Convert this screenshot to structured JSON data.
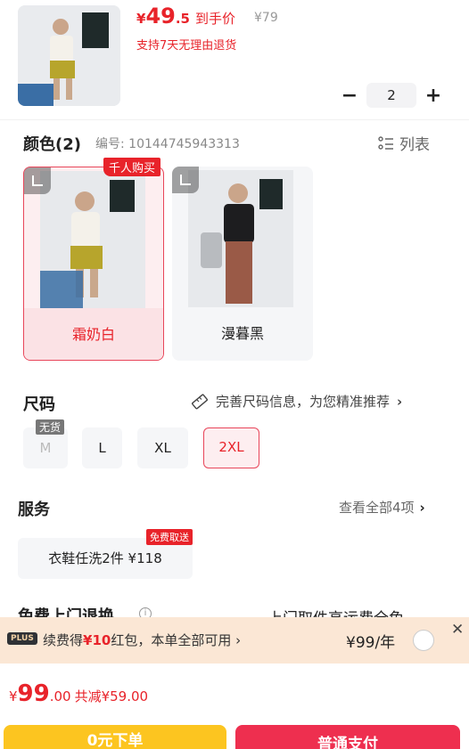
{
  "product": {
    "price_symbol": "¥",
    "price_int": "49",
    "price_dec": ".5",
    "price_label": "到手价",
    "original_price": "¥79",
    "return_policy": "支持7天无理由退货",
    "quantity": "2"
  },
  "color": {
    "title": "颜色(2)",
    "code": "编号: 10144745943313",
    "list_label": "列表",
    "hot_badge": "千人购买",
    "options": [
      {
        "name": "霜奶白",
        "selected": true
      },
      {
        "name": "漫暮黑",
        "selected": false
      }
    ]
  },
  "size": {
    "title": "尺码",
    "hint": "完善尺码信息，为您精准推荐",
    "no_stock": "无货",
    "options": [
      {
        "label": "M",
        "state": "disabled"
      },
      {
        "label": "L",
        "state": "normal"
      },
      {
        "label": "XL",
        "state": "normal"
      },
      {
        "label": "2XL",
        "state": "selected"
      }
    ]
  },
  "service": {
    "title": "服务",
    "view_all": "查看全部4项",
    "item": "衣鞋任洗2件 ¥118",
    "free_badge": "免费取送"
  },
  "partial_row": {
    "left": "免费上门退换",
    "right": "上门取件高运费全免"
  },
  "plus": {
    "tag": "PLUS",
    "text_prefix": "续费得",
    "text_highlight": "¥10",
    "text_suffix": "红包，本单全部可用 ›",
    "price": "¥99/年",
    "close": "✕"
  },
  "footer": {
    "symbol": "¥",
    "total_int": "99",
    "total_dec": ".00",
    "saving": "共减¥59.00",
    "btn_zero": "0元下单",
    "btn_pay": "普通支付"
  },
  "colors": {
    "accent": "#e8232a",
    "pay_button": "#ee2f4f",
    "zero_button": "#fcc520",
    "plus_banner": "#fbe7d5"
  }
}
